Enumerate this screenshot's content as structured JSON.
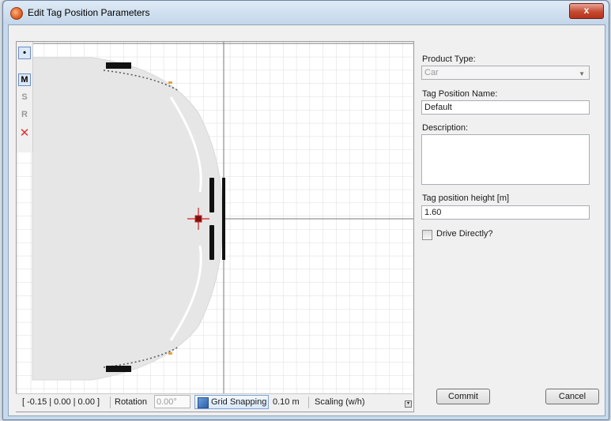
{
  "window": {
    "title": "Edit Tag Position Parameters",
    "close_glyph": "x"
  },
  "toolbar": {
    "tools": [
      {
        "label": "•",
        "icon": "point-icon",
        "selected": true
      },
      {
        "label": "M",
        "selected": true
      },
      {
        "label": "S",
        "selected": false
      },
      {
        "label": "R",
        "selected": false
      },
      {
        "label": "✕",
        "icon": "delete-x-icon",
        "color": "#e03030"
      }
    ]
  },
  "status": {
    "coords": "[ -0.15 | 0.00 | 0.00 ]",
    "rotation_label": "Rotation",
    "rotation_value": "0.00°",
    "grid_snapping_label": "Grid Snapping",
    "grid_value": "0.10 m",
    "scaling_label": "Scaling (w/h)"
  },
  "form": {
    "product_type_label": "Product Type:",
    "product_type_value": "Car",
    "tag_position_name_label": "Tag Position Name:",
    "tag_position_name_value": "Default",
    "description_label": "Description:",
    "description_value": "",
    "height_label": "Tag position height [m]",
    "height_value": "1.60",
    "drive_directly_label": "Drive Directly?",
    "drive_directly_checked": false
  },
  "buttons": {
    "commit": "Commit",
    "cancel": "Cancel"
  },
  "colors": {
    "marker": "#cc2020",
    "car_body": "#e6e6e6",
    "grid": "#dcdcdc",
    "axis": "#7a7a7a"
  }
}
